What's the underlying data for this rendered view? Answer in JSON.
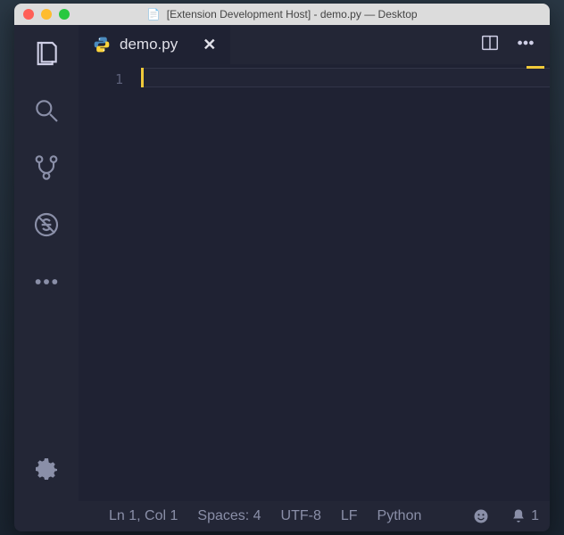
{
  "titlebar": {
    "title": "[Extension Development Host] - demo.py — Desktop"
  },
  "tabs": {
    "active": {
      "label": "demo.py"
    }
  },
  "gutter": {
    "line1": "1"
  },
  "statusbar": {
    "position": "Ln 1, Col 1",
    "spaces": "Spaces: 4",
    "encoding": "UTF-8",
    "eol": "LF",
    "language": "Python",
    "notifications": "1"
  }
}
